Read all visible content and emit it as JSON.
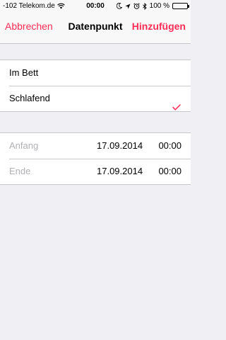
{
  "status_bar": {
    "carrier": "-102 Telekom.de",
    "time": "00:00",
    "battery_percent": "100 %",
    "icons": [
      "wifi-icon",
      "moon-icon",
      "location-arrow-icon",
      "alarm-icon",
      "bluetooth-icon",
      "battery-icon"
    ]
  },
  "navbar": {
    "cancel_label": "Abbrechen",
    "title": "Datenpunkt",
    "add_label": "Hinzufügen"
  },
  "sleep_options": [
    {
      "label": "Im Bett",
      "selected": false
    },
    {
      "label": "Schlafend",
      "selected": true
    }
  ],
  "time_range": {
    "start": {
      "label": "Anfang",
      "date": "17.09.2014",
      "time": "00:00"
    },
    "end": {
      "label": "Ende",
      "date": "17.09.2014",
      "time": "00:00"
    }
  },
  "colors": {
    "accent": "#ff2d55",
    "background": "#efeff4",
    "battery": "#4cd964"
  }
}
